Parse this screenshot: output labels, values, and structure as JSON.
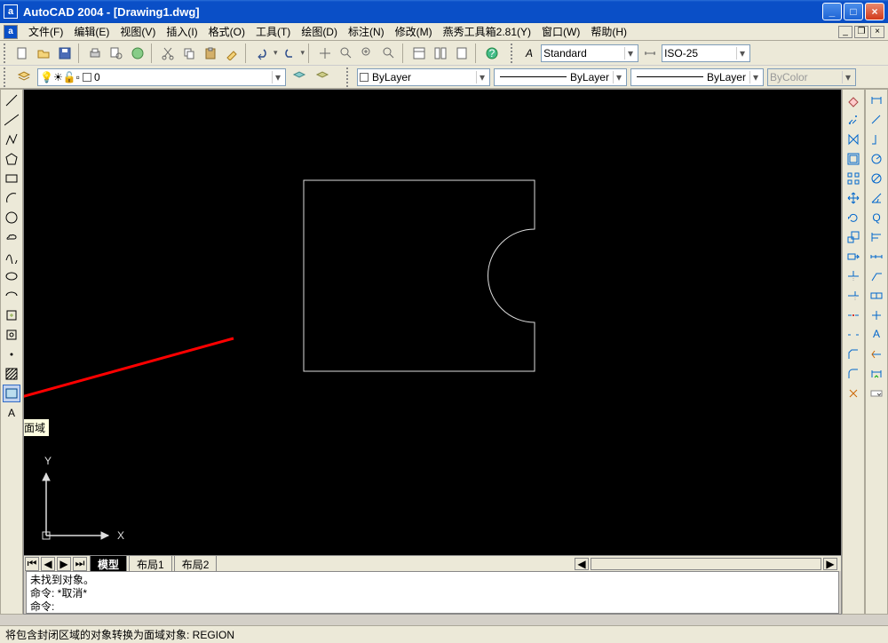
{
  "title": "AutoCAD 2004 - [Drawing1.dwg]",
  "app_icon_letter": "a",
  "menu": {
    "file": "文件(F)",
    "edit": "编辑(E)",
    "view": "视图(V)",
    "insert": "插入(I)",
    "format": "格式(O)",
    "tools": "工具(T)",
    "draw": "绘图(D)",
    "dimension": "标注(N)",
    "modify": "修改(M)",
    "yanxiu": "燕秀工具箱2.81(Y)",
    "window": "窗口(W)",
    "help": "帮助(H)"
  },
  "style_combo": "Standard",
  "dimstyle_combo": "ISO-25",
  "layer_combo": "0",
  "linetype_combo": "ByLayer",
  "lineweight_combo": "ByLayer",
  "color_combo": "ByLayer",
  "plotstyle_combo": "ByColor",
  "tabs": {
    "model": "模型",
    "layout1": "布局1",
    "layout2": "布局2"
  },
  "tooltip_region": "面域",
  "axis": {
    "x": "X",
    "y": "Y"
  },
  "cmd": {
    "line1": "未找到对象。",
    "line2": "命令:  *取消*",
    "line3": "命令:"
  },
  "status": "将包含封闭区域的对象转换为面域对象:  REGION",
  "win_buttons": {
    "min": "_",
    "max": "□",
    "close": "×"
  },
  "mdi_buttons": {
    "min": "_",
    "restore": "❐",
    "close": "×"
  }
}
